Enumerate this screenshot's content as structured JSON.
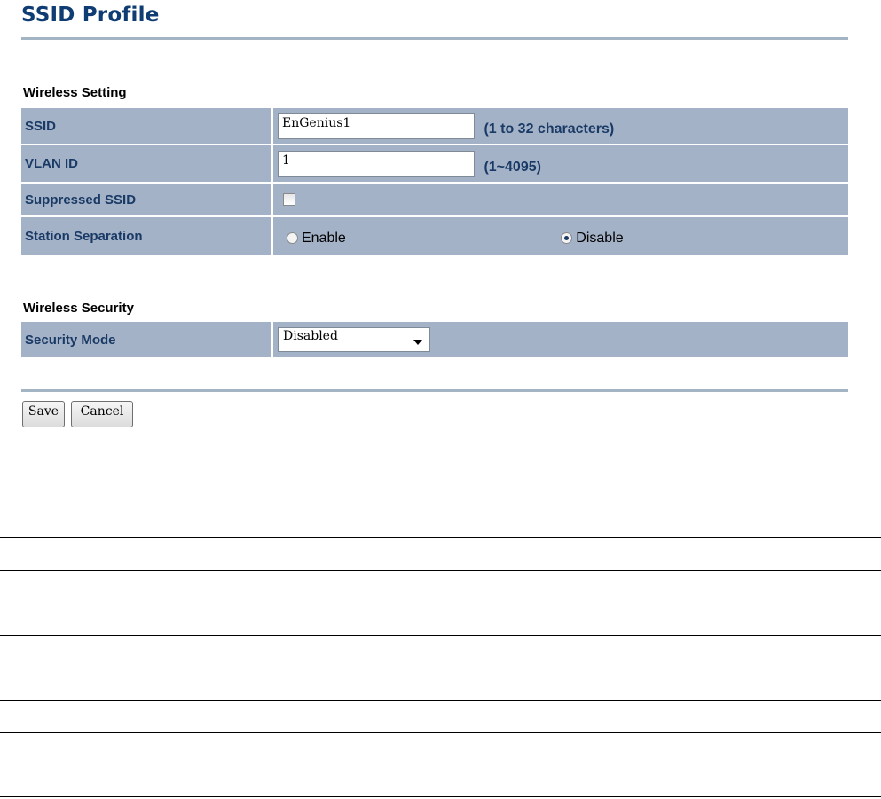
{
  "page": {
    "title": "SSID Profile"
  },
  "wireless_setting": {
    "heading": "Wireless Setting",
    "ssid": {
      "label": "SSID",
      "value": "EnGenius1",
      "hint": "(1 to 32 characters)"
    },
    "vlan_id": {
      "label": "VLAN ID",
      "value": "1",
      "hint": "(1~4095)"
    },
    "suppressed_ssid": {
      "label": "Suppressed SSID",
      "checked": false
    },
    "station_separation": {
      "label": "Station Separation",
      "options": [
        "Enable",
        "Disable"
      ],
      "selected": "Disable"
    }
  },
  "wireless_security": {
    "heading": "Wireless Security",
    "security_mode": {
      "label": "Security Mode",
      "value": "Disabled"
    }
  },
  "buttons": {
    "save": "Save",
    "cancel": "Cancel"
  },
  "colors": {
    "title": "#0f3c73",
    "row_background": "#a3b2c7",
    "label_text": "#1a3a66",
    "rule": "#a3b4c5"
  }
}
